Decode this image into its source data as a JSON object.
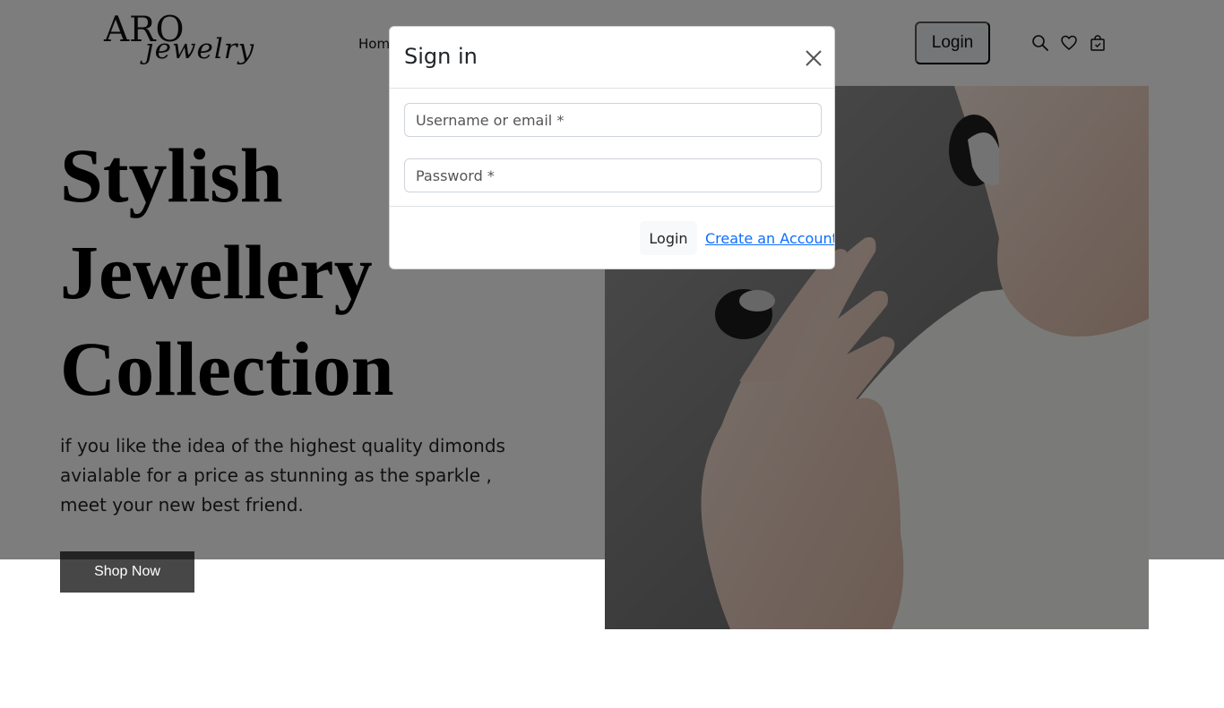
{
  "header": {
    "logo_main": "ARO",
    "logo_script": "jewelry",
    "nav_items": [
      {
        "label": "Hom"
      }
    ],
    "login_label": "Login",
    "icons": [
      "search-icon",
      "heart-icon",
      "shopping-bag-icon"
    ]
  },
  "hero": {
    "title_lines": [
      "Stylish",
      "Jewellery",
      "Collection"
    ],
    "description": "if you like the idea of the highest quality dimonds avialable for a price as stunning as the sparkle , meet your new best friend.",
    "shop_button": "Shop Now",
    "image": "model-with-black-jewellery-photo"
  },
  "modal": {
    "title": "Sign in",
    "username_placeholder": "Username or email *",
    "password_placeholder": "Password *",
    "login_button": "Login",
    "create_account_link": "Create an Account"
  },
  "colors": {
    "backdrop": "#000000",
    "link": "#0d6efd",
    "shop_button": "#474747",
    "header_login_bg": "#e9ecef"
  }
}
